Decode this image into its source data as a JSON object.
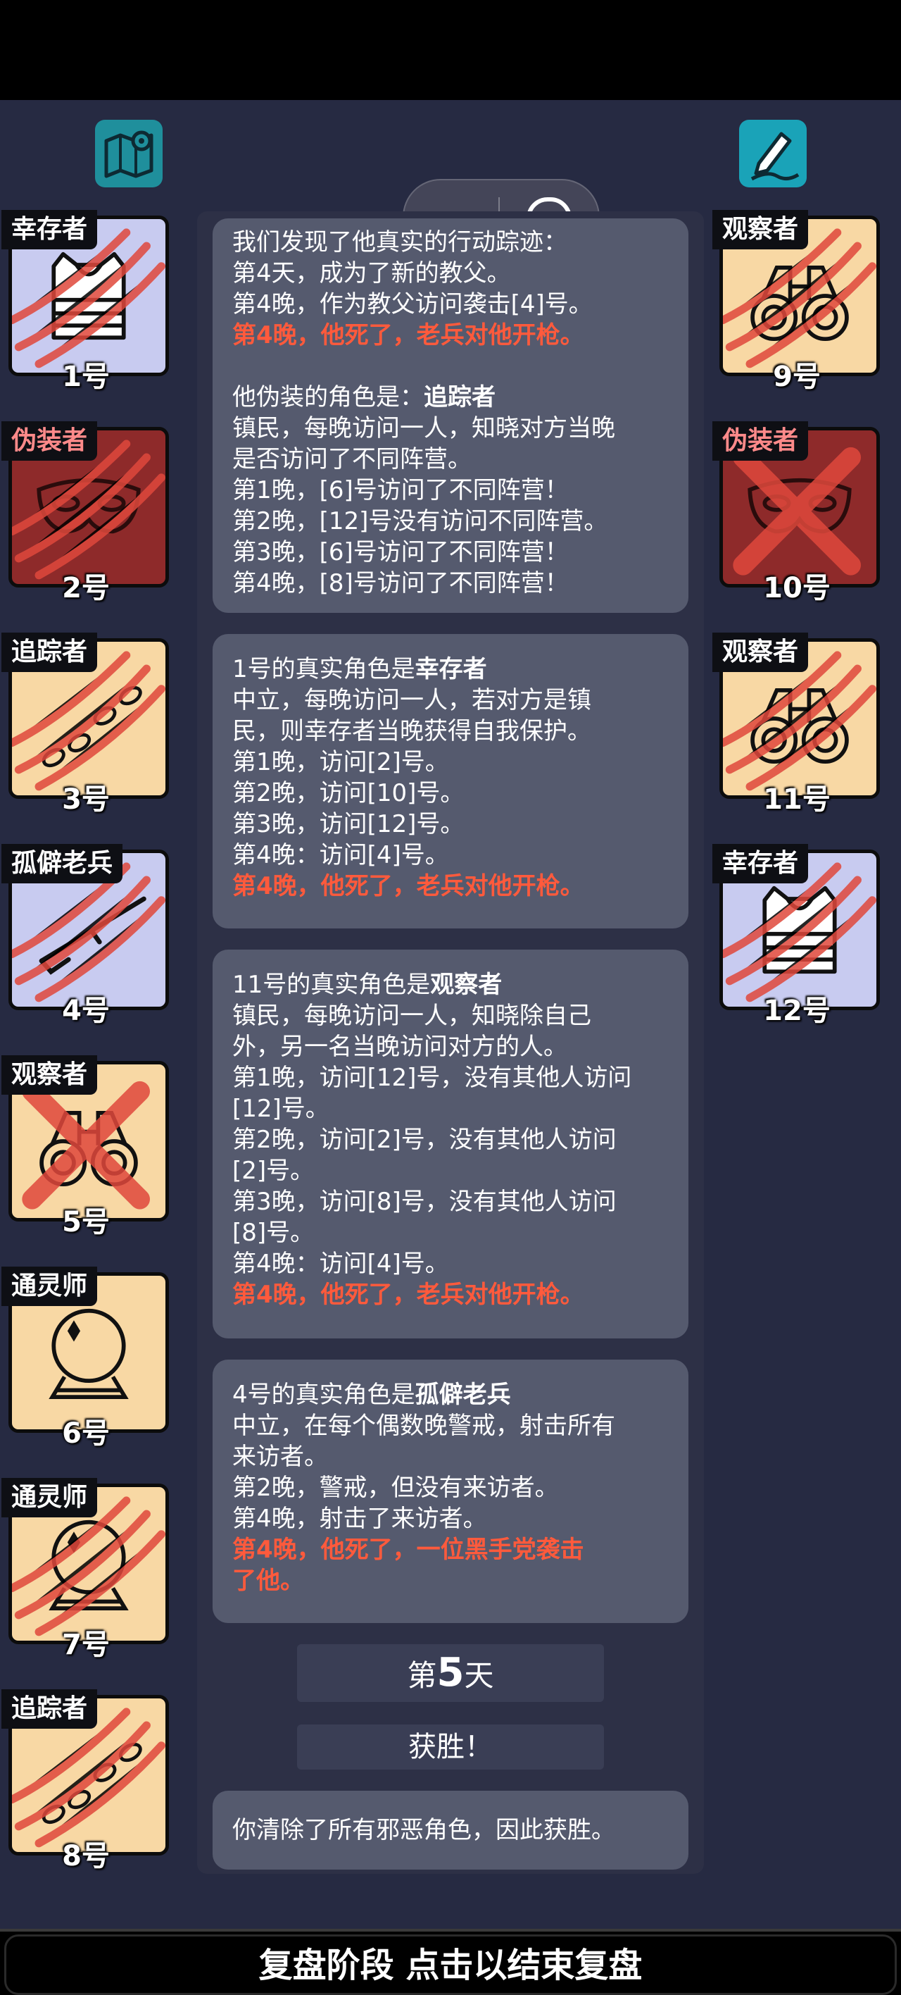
{
  "players_left": [
    {
      "role": "幸存者",
      "num": "1号",
      "bg": "blue",
      "icon": "vest-icon",
      "status": "attacked",
      "evil": false
    },
    {
      "role": "伪装者",
      "num": "2号",
      "bg": "red",
      "icon": "mask-icon",
      "status": "attacked",
      "evil": true
    },
    {
      "role": "追踪者",
      "num": "3号",
      "bg": "peach",
      "icon": "footprints-icon",
      "status": "attacked",
      "evil": false
    },
    {
      "role": "孤僻老兵",
      "num": "4号",
      "bg": "blue",
      "icon": "rifle-icon",
      "status": "attacked",
      "evil": false
    },
    {
      "role": "观察者",
      "num": "5号",
      "bg": "peach",
      "icon": "binoculars-icon",
      "status": "eliminated",
      "evil": false
    },
    {
      "role": "通灵师",
      "num": "6号",
      "bg": "peach",
      "icon": "crystal-ball-icon",
      "status": "alive",
      "evil": false
    },
    {
      "role": "通灵师",
      "num": "7号",
      "bg": "peach",
      "icon": "crystal-ball-icon",
      "status": "attacked",
      "evil": false
    },
    {
      "role": "追踪者",
      "num": "8号",
      "bg": "peach",
      "icon": "footprints-icon",
      "status": "attacked",
      "evil": false
    }
  ],
  "players_right": [
    {
      "role": "观察者",
      "num": "9号",
      "bg": "peach",
      "icon": "binoculars-icon",
      "status": "attacked",
      "evil": false
    },
    {
      "role": "伪装者",
      "num": "10号",
      "bg": "red",
      "icon": "mask-icon",
      "status": "eliminated",
      "evil": true
    },
    {
      "role": "观察者",
      "num": "11号",
      "bg": "peach",
      "icon": "binoculars-icon",
      "status": "attacked",
      "evil": false
    },
    {
      "role": "幸存者",
      "num": "12号",
      "bg": "blue",
      "icon": "vest-icon",
      "status": "attacked",
      "evil": false
    }
  ],
  "log": {
    "box1": {
      "l1": "我们发现了他真实的行动踪迹：",
      "l2": "第4天，成为了新的教父。",
      "l3": "第4晚，作为教父访问袭击[4]号。",
      "l4": "第4晚，他死了，老兵对他开枪。",
      "l5a": "他伪装的角色是：",
      "l5b": "追踪者",
      "l6": "镇民，每晚访问一人，知晓对方当晚",
      "l7": "是否访问了不同阵营。",
      "l8": "第1晚，[6]号访问了不同阵营！",
      "l9": "第2晚，[12]号没有访问不同阵营。",
      "l10": "第3晚，[6]号访问了不同阵营！",
      "l11": "第4晚，[8]号访问了不同阵营！"
    },
    "box2": {
      "l1a": "1号的真实角色是",
      "l1b": "幸存者",
      "l2": "中立，每晚访问一人，若对方是镇",
      "l3": "民，则幸存者当晚获得自我保护。",
      "l4": "第1晚，访问[2]号。",
      "l5": "第2晚，访问[10]号。",
      "l6": "第3晚，访问[12]号。",
      "l7": "第4晚：访问[4]号。",
      "l8": "第4晚，他死了，老兵对他开枪。"
    },
    "box3": {
      "l1a": "11号的真实角色是",
      "l1b": "观察者",
      "l2": "镇民，每晚访问一人，知晓除自己",
      "l3": "外，另一名当晚访问对方的人。",
      "l4": "第1晚，访问[12]号，没有其他人访问",
      "l5": "[12]号。",
      "l6": "第2晚，访问[2]号，没有其他人访问",
      "l7": "[2]号。",
      "l8": "第3晚，访问[8]号，没有其他人访问",
      "l9": "[8]号。",
      "l10": "第4晚：访问[4]号。",
      "l11": "第4晚，他死了，老兵对他开枪。"
    },
    "box4": {
      "l1a": "4号的真实角色是",
      "l1b": "孤僻老兵",
      "l2": "中立，在每个偶数晚警戒，射击所有",
      "l3": "来访者。",
      "l4": "第2晚，警戒，但没有来访者。",
      "l5": "第4晚，射击了来访者。",
      "l6": "第4晚，他死了，一位黑手党袭击",
      "l7": "了他。"
    },
    "day_prefix": "第",
    "day_number": "5",
    "day_suffix": "天",
    "victory": "获胜！",
    "result": "你清除了所有邪恶角色，因此获胜。"
  },
  "bottom_bar": "复盘阶段 点击以结束复盘",
  "colors": {
    "danger": "#ff5a3c",
    "evil_label": "#ff8a8a",
    "panel": "#555a6e",
    "background": "#262a42"
  }
}
